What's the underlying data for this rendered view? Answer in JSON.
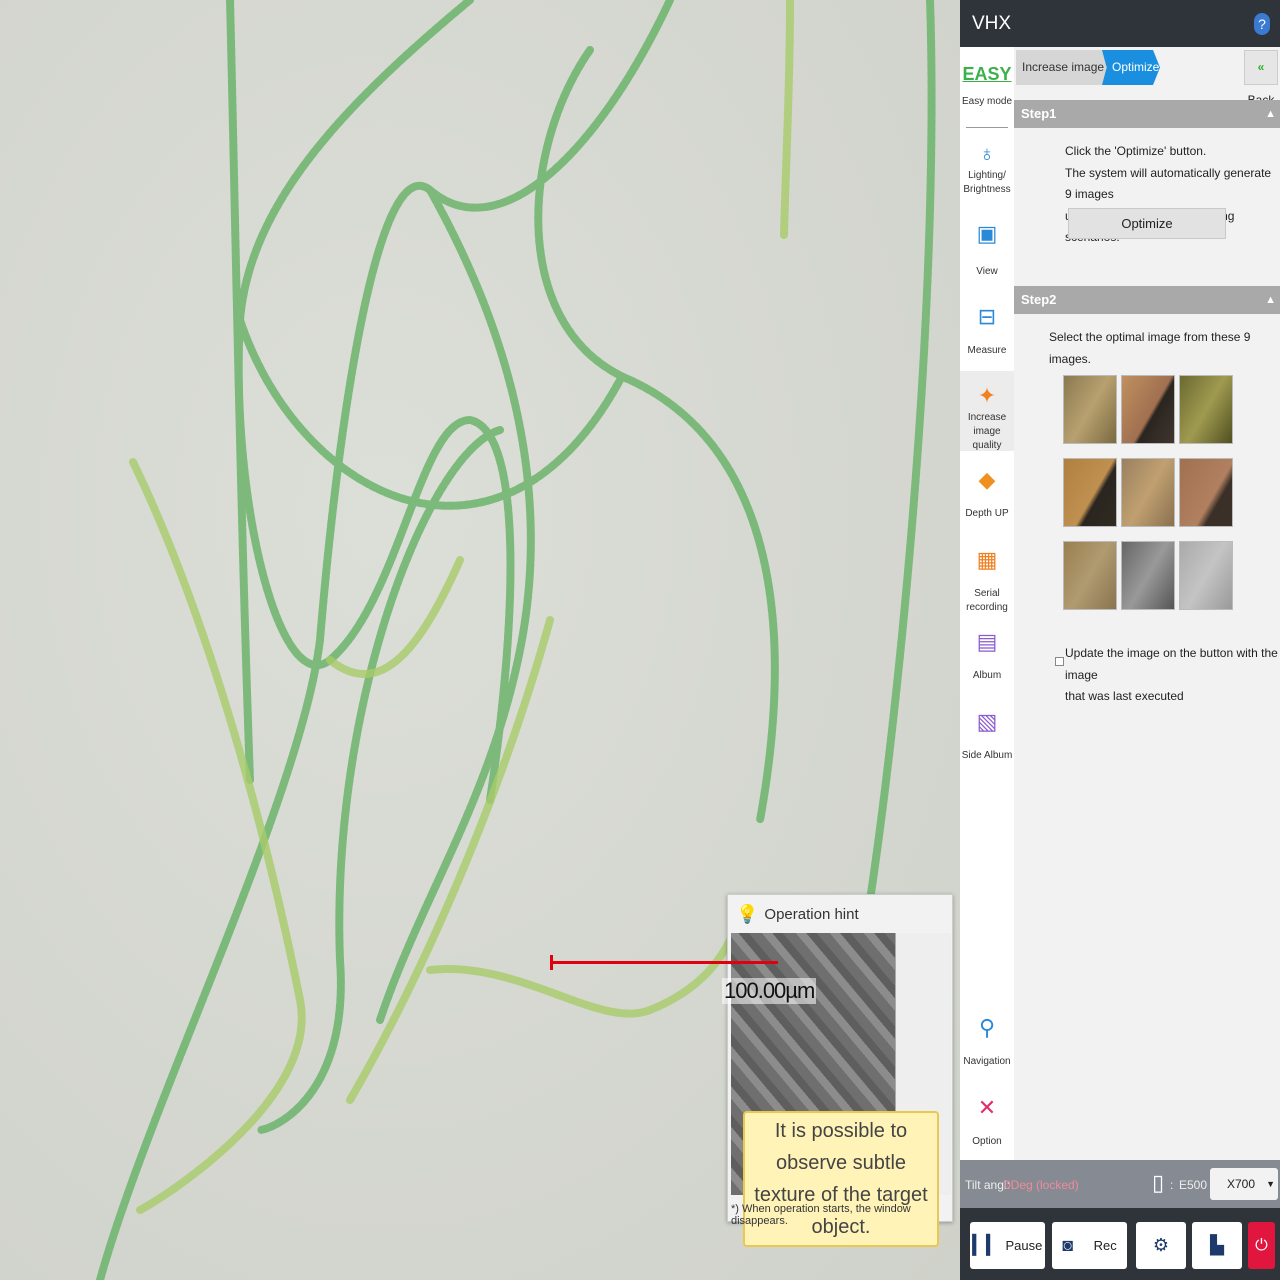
{
  "app": {
    "title": "VHX",
    "help": "?"
  },
  "view": {
    "scale_label": "100.00µm"
  },
  "hint": {
    "title": "Operation hint",
    "bubble_line1": "It is possible to observe subtle",
    "bubble_line2": "texture of the target object.",
    "footnote": "*) When operation starts, the window disappears."
  },
  "sidebar": [
    {
      "label": "Easy mode",
      "icon": "EASY"
    },
    {
      "label": "Lighting/ Brightness"
    },
    {
      "label": "View"
    },
    {
      "label": "Measure"
    },
    {
      "label": "Increase image quality"
    },
    {
      "label": "Depth UP"
    },
    {
      "label": "Serial recording"
    },
    {
      "label": "Album"
    },
    {
      "label": "Side Album"
    },
    {
      "label": "Navigation"
    },
    {
      "label": "Option"
    }
  ],
  "breadcrumb": [
    "Increase image quality",
    "Optimize"
  ],
  "back_label": "Back",
  "step1": {
    "title": "Step1",
    "lines": [
      "Click the 'Optimize' button.",
      "The system will automatically generate 9 images",
      "using unique repeatable lighting scenarios."
    ],
    "button": "Optimize"
  },
  "step2": {
    "title": "Step2",
    "text": "Select the optimal image from these 9 images.",
    "checkbox_line1": "Update the image on the button with the image",
    "checkbox_line2": "that was last executed"
  },
  "status": {
    "tilt_label": "Tilt angl:",
    "tilt_value": "0Deg (locked)",
    "lens": "E500",
    "zoom": "X700",
    "tilt_color": "#f08c9a"
  },
  "controls": {
    "pause": "Pause",
    "rec": "Rec"
  }
}
